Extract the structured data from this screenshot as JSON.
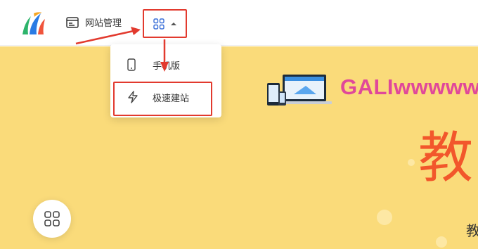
{
  "header": {
    "logo_icon": "sail-logo-icon",
    "nav_site_icon": "browser-window-icon",
    "nav_site_label": "网站管理",
    "apps_icon": "grid-apps-icon",
    "apps_caret_icon": "caret-up-icon"
  },
  "dropdown": {
    "items": [
      {
        "icon": "phone-icon",
        "label": "手机版"
      },
      {
        "icon": "lightning-icon",
        "label": "极速建站"
      }
    ]
  },
  "banner": {
    "headline": "GALIwwwwwww",
    "big_char": "教",
    "small_char": "教",
    "illustration": "devices-illustration"
  },
  "fab": {
    "icon": "grid-apps-icon"
  },
  "annotations": {
    "color": "#e23a2e"
  },
  "colors": {
    "banner": "#fadb7a",
    "headline": "#e0489a",
    "big_char": "#f2572b"
  }
}
